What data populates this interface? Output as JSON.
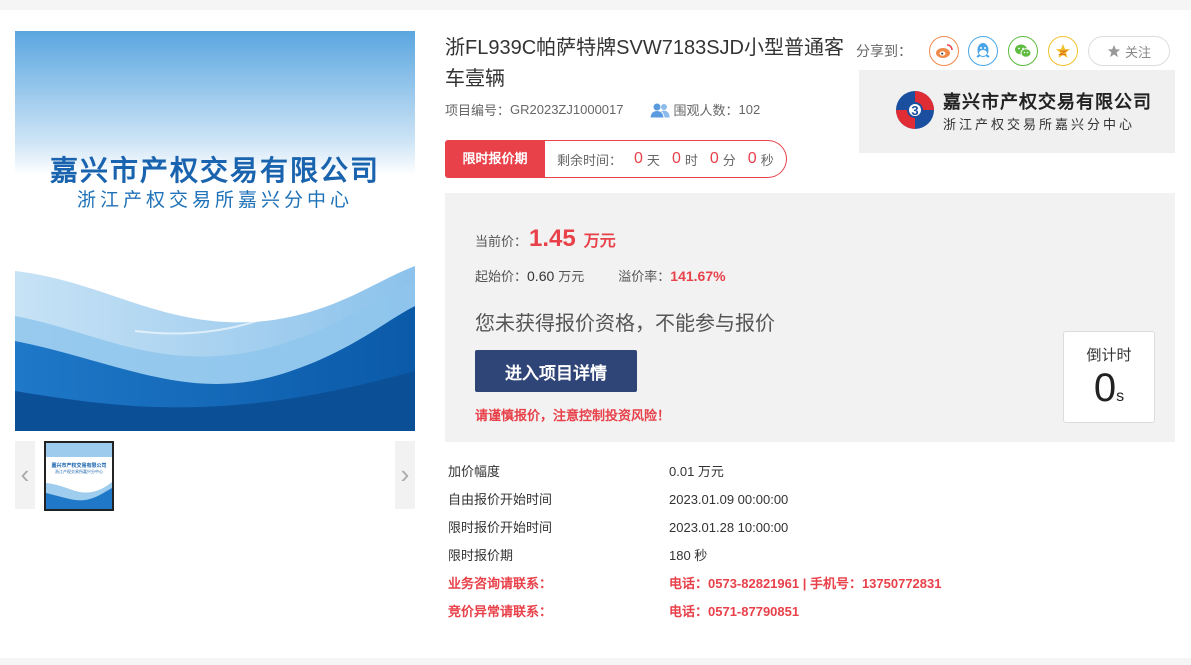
{
  "colors": {
    "accent_red": "#e8414a",
    "button_navy": "#2f4577",
    "brand_blue": "#1a63ae"
  },
  "image": {
    "org_name": "嘉兴市产权交易有限公司",
    "org_sub": "浙江产权交易所嘉兴分中心",
    "prev_icon": "chevron-left-icon",
    "next_icon": "chevron-right-icon"
  },
  "item": {
    "title": "浙FL939C帕萨特牌SVW7183SJD小型普通客车壹辆",
    "project_no_label": "项目编号：",
    "project_no": "GR2023ZJ1000017",
    "viewers_label": "围观人数：",
    "viewers": "102"
  },
  "share": {
    "label": "分享到：",
    "buttons": [
      "weibo-icon",
      "qq-icon",
      "wechat-icon",
      "qzone-icon"
    ],
    "follow_label": "关注"
  },
  "org_banner": {
    "name": "嘉兴市产权交易有限公司",
    "sub": "浙江产权交易所嘉兴分中心"
  },
  "countdown_bar": {
    "tag": "限时报价期",
    "remain_label": "剩余时间：",
    "days": "0",
    "days_unit": "天",
    "hours": "0",
    "hours_unit": "时",
    "minutes": "0",
    "minutes_unit": "分",
    "seconds": "0",
    "seconds_unit": "秒"
  },
  "price": {
    "current_label": "当前价：",
    "current_value": "1.45",
    "current_unit": "万元",
    "start_label": "起始价：",
    "start_value": "0.60",
    "start_unit": "万元",
    "premium_label": "溢价率：",
    "premium_value": "141.67%",
    "notice": "您未获得报价资格，不能参与报价",
    "detail_button": "进入项目详情",
    "warning": "请谨慎报价，注意控制投资风险！",
    "countdown_label": "倒计时",
    "countdown_value": "0",
    "countdown_unit": "s"
  },
  "info": [
    {
      "label": "加价幅度",
      "value": "0.01 万元"
    },
    {
      "label": "自由报价开始时间",
      "value": "2023.01.09 00:00:00"
    },
    {
      "label": "限时报价开始时间",
      "value": "2023.01.28 10:00:00"
    },
    {
      "label": "限时报价期",
      "value": "180 秒"
    },
    {
      "label": "业务咨询请联系：",
      "value": "电话：0573-82821961 | 手机号：13750772831"
    },
    {
      "label": "竞价异常请联系：",
      "value": "电话：0571-87790851"
    }
  ]
}
